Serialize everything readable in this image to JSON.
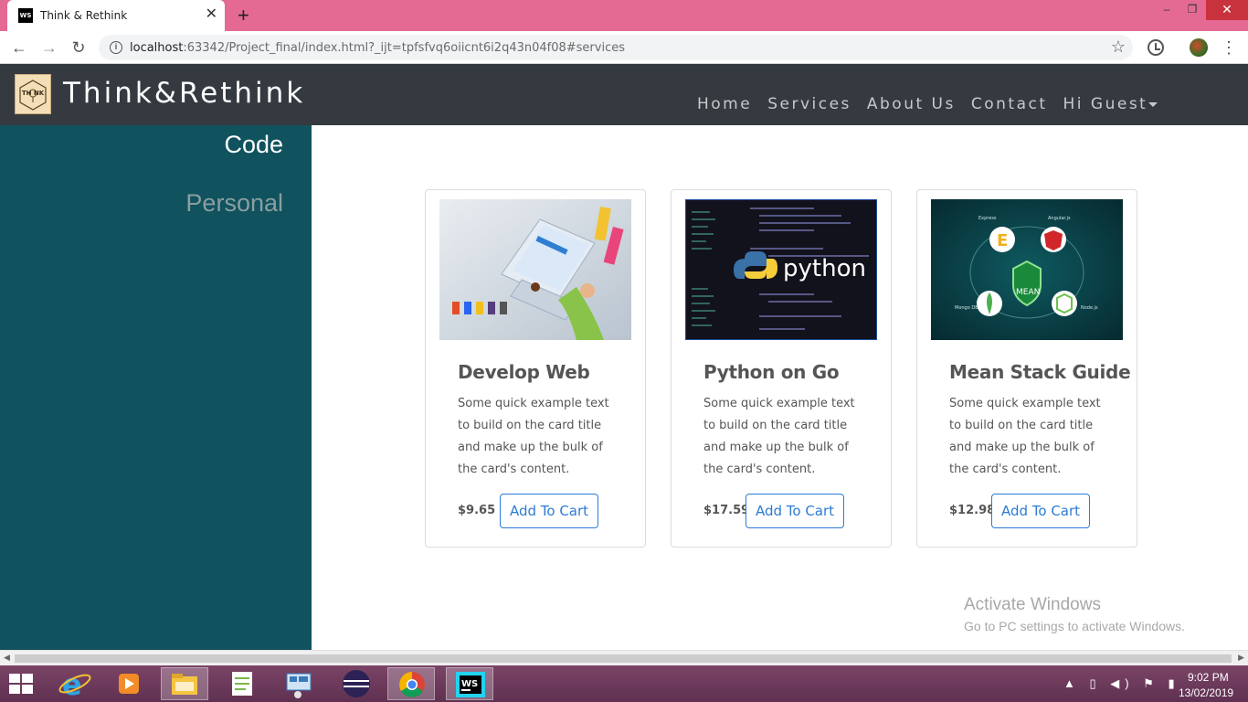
{
  "browser": {
    "tab_title": "Think & Rethink",
    "tab_favicon_text": "WS",
    "url_host": "localhost",
    "url_rest": ":63342/Project_final/index.html?_ijt=tpfsfvq6oiicnt6i2q43n04f08#services"
  },
  "site": {
    "brand_name": "Think&Rethink",
    "brand_logo_text": "TH  NK",
    "nav": [
      "Home",
      "Services",
      "About Us",
      "Contact",
      "Hi Guest"
    ]
  },
  "sidebar": {
    "items": [
      {
        "label": "Code",
        "active": true
      },
      {
        "label": "Personal",
        "active": false
      }
    ]
  },
  "cards": [
    {
      "title": "Develop Web",
      "text": "Some quick example text to build on the card title and make up the bulk of the card's content.",
      "price": "$9.65",
      "button": "Add To Cart",
      "image": "web-development-illustration"
    },
    {
      "title": "Python on Go",
      "text": "Some quick example text to build on the card title and make up the bulk of the card's content.",
      "price": "$17.59",
      "button": "Add To Cart",
      "image": "python-logo-on-code",
      "image_text": "python"
    },
    {
      "title": "Mean Stack Guide",
      "text": "Some quick example text to build on the card title and make up the bulk of the card's content.",
      "price": "$12.98",
      "button": "Add To Cart",
      "image": "mean-stack-diagram",
      "image_labels": [
        "Express",
        "Angular.js",
        "MEAN",
        "Mongo DB",
        "Node.js"
      ]
    }
  ],
  "watermark": {
    "title": "Activate Windows",
    "subtitle": "Go to PC settings to activate Windows."
  },
  "taskbar": {
    "time": "9:02 PM",
    "date": "13/02/2019",
    "apps": [
      "internet-explorer-icon",
      "media-player-icon",
      "file-explorer-icon",
      "notepad-plus-icon",
      "remote-desktop-icon",
      "eclipse-icon",
      "chrome-icon",
      "webstorm-icon"
    ]
  },
  "colors": {
    "titlebar": "#e46a93",
    "navbar": "#343a40",
    "sidebar": "#10525e",
    "button_accent": "#2c7bd4"
  }
}
